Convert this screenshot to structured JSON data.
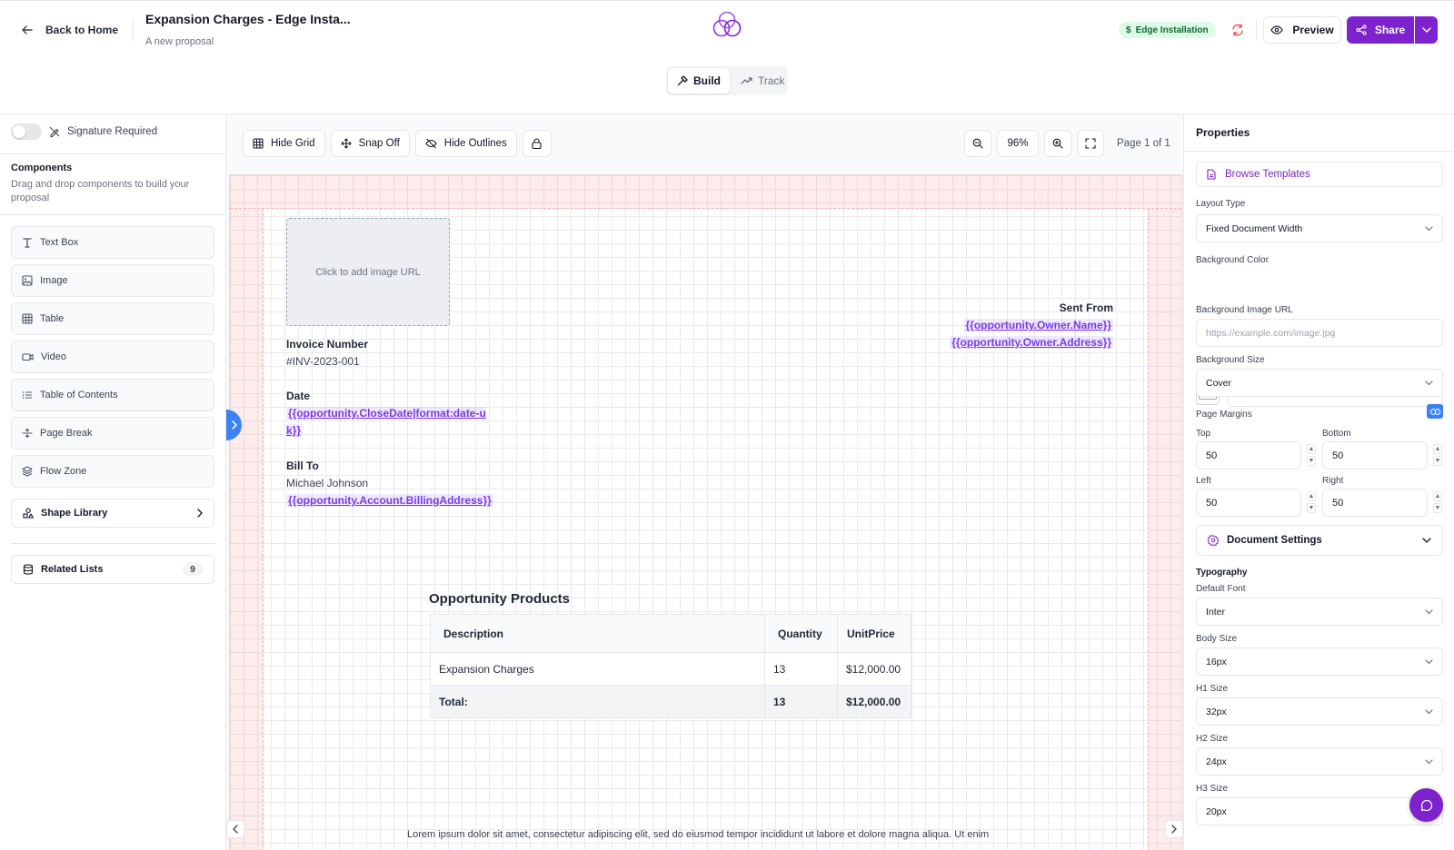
{
  "header": {
    "back_label": "Back to Home",
    "doc_title": "Expansion Charges - Edge Insta...",
    "doc_subtitle": "A new proposal",
    "modes": [
      "Build",
      "Track"
    ],
    "active_mode": "Build",
    "badge": "Edge Installation",
    "preview_label": "Preview",
    "share_label": "Share",
    "accent_color": "#7e22ce"
  },
  "left_panel": {
    "signature_label": "Signature Required",
    "signature_required": false,
    "components_title": "Components",
    "components_desc": "Drag and drop components to build your proposal",
    "components": [
      {
        "label": "Text Box",
        "icon": "text-icon"
      },
      {
        "label": "Image",
        "icon": "image-icon"
      },
      {
        "label": "Table",
        "icon": "table-icon"
      },
      {
        "label": "Video",
        "icon": "video-icon"
      },
      {
        "label": "Table of Contents",
        "icon": "list-icon"
      },
      {
        "label": "Page Break",
        "icon": "page-break-icon"
      },
      {
        "label": "Flow Zone",
        "icon": "layers-icon"
      }
    ],
    "shape_library": "Shape Library",
    "related_lists": "Related Lists",
    "related_count": "9"
  },
  "toolbar": {
    "hide_grid": "Hide Grid",
    "snap": "Snap Off",
    "hide_outlines": "Hide Outlines",
    "zoom": "96%",
    "page_indicator": "Page 1 of 1"
  },
  "document": {
    "image_placeholder": "Click to add image URL",
    "sent_from_label": "Sent From",
    "sent_from_name": "{{opportunity.Owner.Name}}",
    "sent_from_address": "{{opportunity.Owner.Address}}",
    "invoice_label": "Invoice Number",
    "invoice_value": "#INV-2023-001",
    "date_label": "Date",
    "date_value": "{{opportunity.CloseDate|format:date-uk}}",
    "bill_to_label": "Bill To",
    "bill_to_name": "Michael Johnson",
    "bill_to_address": "{{opportunity.Account.BillingAddress}}",
    "products_title": "Opportunity Products",
    "table": {
      "headers": [
        "Description",
        "Quantity",
        "UnitPrice"
      ],
      "rows": [
        [
          "Expansion Charges",
          "13",
          "$12,000.00"
        ]
      ],
      "total": [
        "Total:",
        "13",
        "$12,000.00"
      ]
    },
    "lorem": "Lorem ipsum dolor sit amet, consectetur adipiscing elit, sed do eiusmod tempor incididunt ut labore et dolore magna aliqua. Ut enim"
  },
  "properties": {
    "title": "Properties",
    "browse_templates": "Browse Templates",
    "layout_type_label": "Layout Type",
    "layout_type": "Fixed Document Width",
    "bg_color_label": "Background Color",
    "bg_color": "#FFFFFF",
    "bg_image_label": "Background Image URL",
    "bg_image_placeholder": "https://example.com/image.jpg",
    "bg_size_label": "Background Size",
    "bg_size": "Cover",
    "margins_label": "Page Margins",
    "margins": {
      "top_label": "Top",
      "top": "50",
      "bottom_label": "Bottom",
      "bottom": "50",
      "left_label": "Left",
      "left": "50",
      "right_label": "Right",
      "right": "50"
    },
    "doc_settings": "Document Settings",
    "typography": "Typography",
    "default_font_label": "Default Font",
    "default_font": "Inter",
    "body_size_label": "Body Size",
    "body_size": "16px",
    "h1_label": "H1 Size",
    "h1_size": "32px",
    "h2_label": "H2 Size",
    "h2_size": "24px",
    "h3_label": "H3 Size",
    "h3_size": "20px"
  }
}
